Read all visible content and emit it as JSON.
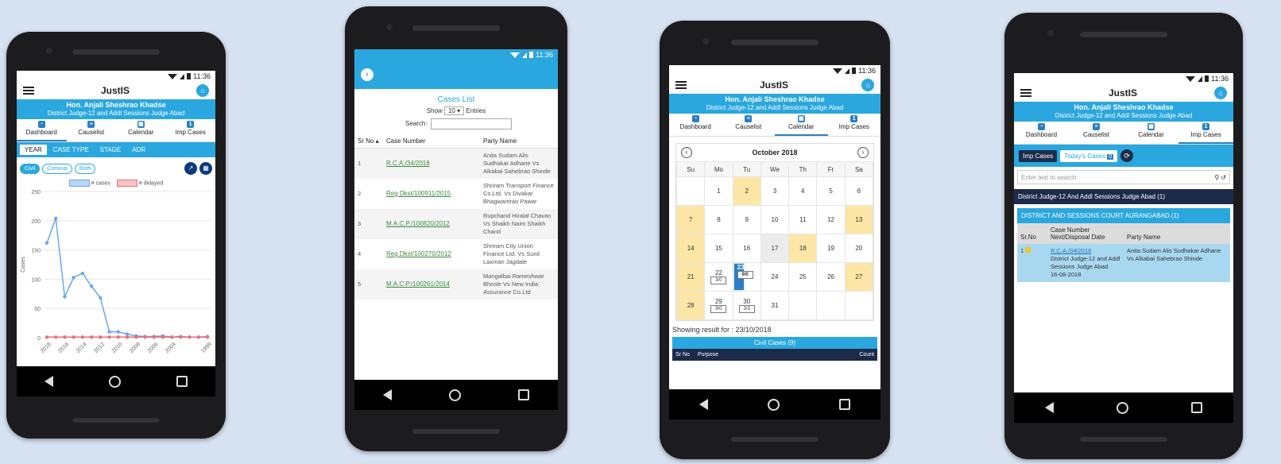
{
  "status": {
    "time": "11:36"
  },
  "app": {
    "title": "JustIS",
    "judge_name": "Hon. Anjali Sheshrao Khadse",
    "judge_designation": "District Judge-12 and Addl Sessions Judge Abad"
  },
  "tabs": [
    "Dashboard",
    "Causelist",
    "Calendar",
    "Imp Cases"
  ],
  "dashboard": {
    "subtabs": [
      "YEAR",
      "CASE TYPE",
      "STAGE",
      "ADR"
    ],
    "filters": [
      "Civil",
      "Criminal",
      "Both"
    ],
    "colors": {
      "cases": "#6aa8ef",
      "delayed": "#e8707a"
    },
    "chart_data": {
      "type": "line",
      "x": [
        "2018",
        "2017",
        "2016",
        "2015",
        "2014",
        "2013",
        "2012",
        "2011",
        "2010",
        "2009",
        "2008",
        "2007",
        "2006",
        "2005",
        "2004",
        "2003",
        "2002",
        "2001",
        "1999"
      ],
      "x_ticks": [
        "2018",
        "2016",
        "2014",
        "2012",
        "2010",
        "2008",
        "2006",
        "2004",
        "1999"
      ],
      "series": [
        {
          "name": "# cases",
          "values": [
            162,
            204,
            70,
            103,
            110,
            88,
            68,
            10,
            10,
            6,
            3,
            2,
            2,
            3,
            1,
            2,
            1,
            1,
            2
          ]
        },
        {
          "name": "# delayed",
          "values": [
            1,
            1,
            1,
            1,
            1,
            1,
            1,
            1,
            1,
            1,
            1,
            1,
            1,
            1,
            1,
            1,
            1,
            1,
            1
          ]
        }
      ],
      "ylabel": "Cases",
      "yticks": [
        0,
        50,
        100,
        150,
        200,
        250
      ],
      "ylim": [
        0,
        250
      ],
      "legend": "top"
    }
  },
  "cases_list": {
    "title": "Cases List",
    "show_label": "Show",
    "entries_value": "10",
    "entries_label": "Entries",
    "search_label": "Search:",
    "columns": [
      "Sr No",
      "Case Number",
      "Party Name"
    ],
    "rows": [
      {
        "sr": "1",
        "case": "R.C.A./34/2018",
        "party": "Anita Sudam Alis Sudhakar Adhane Vs Alkabai Sahebrao Shinde"
      },
      {
        "sr": "2",
        "case": "Reg Dkst/100911/2015",
        "party": "Shriram Transport Finance Co.Ltd. Vs Divakar Bhagwantrao Pawar"
      },
      {
        "sr": "3",
        "case": "M.A.C.P./100820/2012",
        "party": "Rupchand Hiralal Chavan Vs Shaikh Naim Shaikh Chand"
      },
      {
        "sr": "4",
        "case": "Reg Dkst/100270/2012",
        "party": "Shriram City Union Finance Ltd. Vs Sunil Laxman Jagdale"
      },
      {
        "sr": "5",
        "case": "M.A.C.P./100261/2014",
        "party": "Mangalbai Rameshwar Bhosle Vs New India Assurance Co.Ltd"
      }
    ]
  },
  "calendar": {
    "month": "October 2018",
    "weekdays": [
      "Su",
      "Mo",
      "Tu",
      "We",
      "Th",
      "Fr",
      "Sa"
    ],
    "weeks": [
      [
        {
          "d": ""
        },
        {
          "d": "1"
        },
        {
          "d": "2",
          "h": 1
        },
        {
          "d": "3"
        },
        {
          "d": "4"
        },
        {
          "d": "5"
        },
        {
          "d": "6"
        }
      ],
      [
        {
          "d": "7",
          "h": 1
        },
        {
          "d": "8"
        },
        {
          "d": "9"
        },
        {
          "d": "10"
        },
        {
          "d": "11"
        },
        {
          "d": "12"
        },
        {
          "d": "13",
          "h": 1
        }
      ],
      [
        {
          "d": "14",
          "h": 1
        },
        {
          "d": "15"
        },
        {
          "d": "16"
        },
        {
          "d": "17",
          "g": 1
        },
        {
          "d": "18",
          "h": 1
        },
        {
          "d": "19"
        },
        {
          "d": "20"
        }
      ],
      [
        {
          "d": "21",
          "h": 1
        },
        {
          "d": "22",
          "c": "3/0"
        },
        {
          "d": "23",
          "c": "9/0",
          "s": 1
        },
        {
          "d": "24"
        },
        {
          "d": "25"
        },
        {
          "d": "26"
        },
        {
          "d": "27",
          "h": 1
        }
      ],
      [
        {
          "d": "28",
          "h": 1
        },
        {
          "d": "29",
          "c": "9/0"
        },
        {
          "d": "30",
          "c": "3/3"
        },
        {
          "d": "31"
        },
        {
          "d": ""
        },
        {
          "d": ""
        },
        {
          "d": ""
        }
      ]
    ],
    "showing": "Showing result for : 23/10/2018",
    "civil_cases": "Civil Cases  (9)",
    "columns": [
      "Sr No",
      "Purpose",
      "Count"
    ]
  },
  "imp_cases": {
    "imp_btn": "Imp Cases",
    "today_btn": "Today's Cases",
    "today_count": "0",
    "search_placeholder": "Enter text to search",
    "group": "District Judge-12 And Addl Sessions Judge Abad (1)",
    "court": "DISTRICT AND SESSIONS COURT AURANGABAD.(1)",
    "columns": [
      "Sr.No",
      "Case Number Next/Disposal Date",
      "Party Name"
    ],
    "row": {
      "sr": "1",
      "case": "R.C.A./34/2018",
      "court": "District Judge-12 and Addl Sessions Judge Abad",
      "date": "16-08-2018",
      "party": "Anita Sudam Alis Sudhakar Adhane Vs Alkabai Sahebrao Shinde"
    }
  }
}
